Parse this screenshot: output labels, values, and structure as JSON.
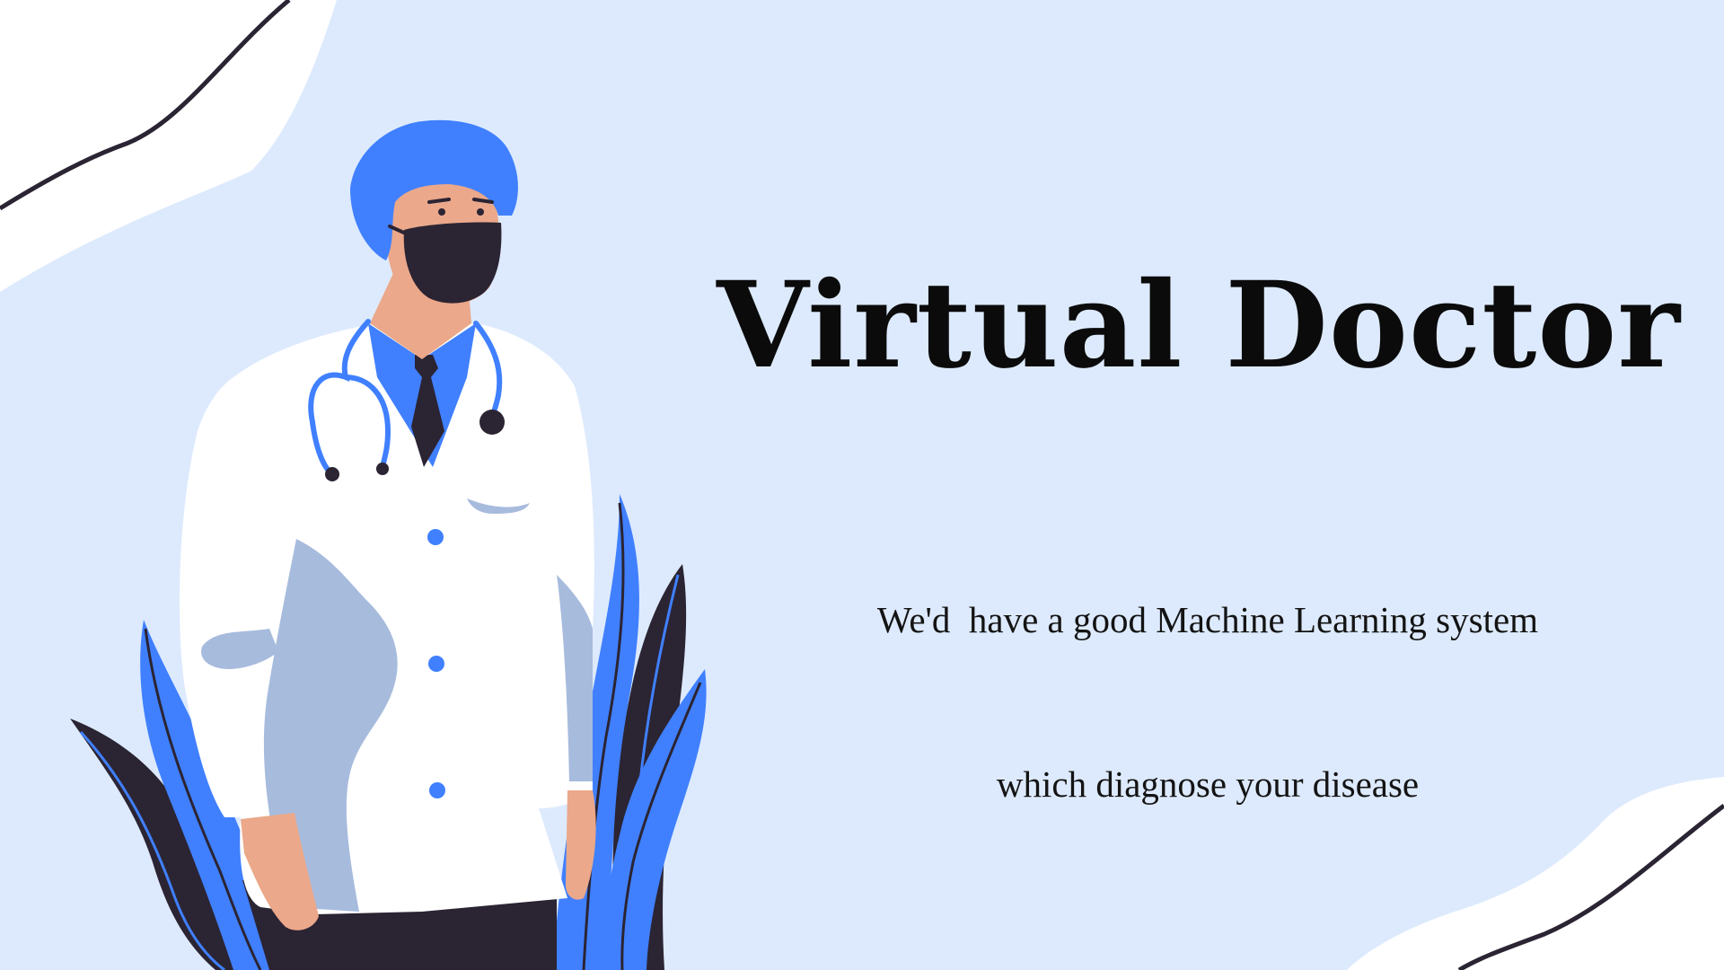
{
  "slide": {
    "title": "Virtual Doctor",
    "subtitle_lines": [
      "We'd  have a good Machine Learning system",
      "which diagnose your disease"
    ]
  },
  "colors": {
    "background": "#ddeafd",
    "accent_blue": "#4080ff",
    "dark": "#2b2433",
    "skin": "#eba88a",
    "coat_shadow": "#a7bbdd",
    "white": "#ffffff"
  },
  "illustration": {
    "subject": "doctor-illustration",
    "icons": [
      "stethoscope-icon",
      "face-mask-icon",
      "leaf-icon"
    ]
  }
}
